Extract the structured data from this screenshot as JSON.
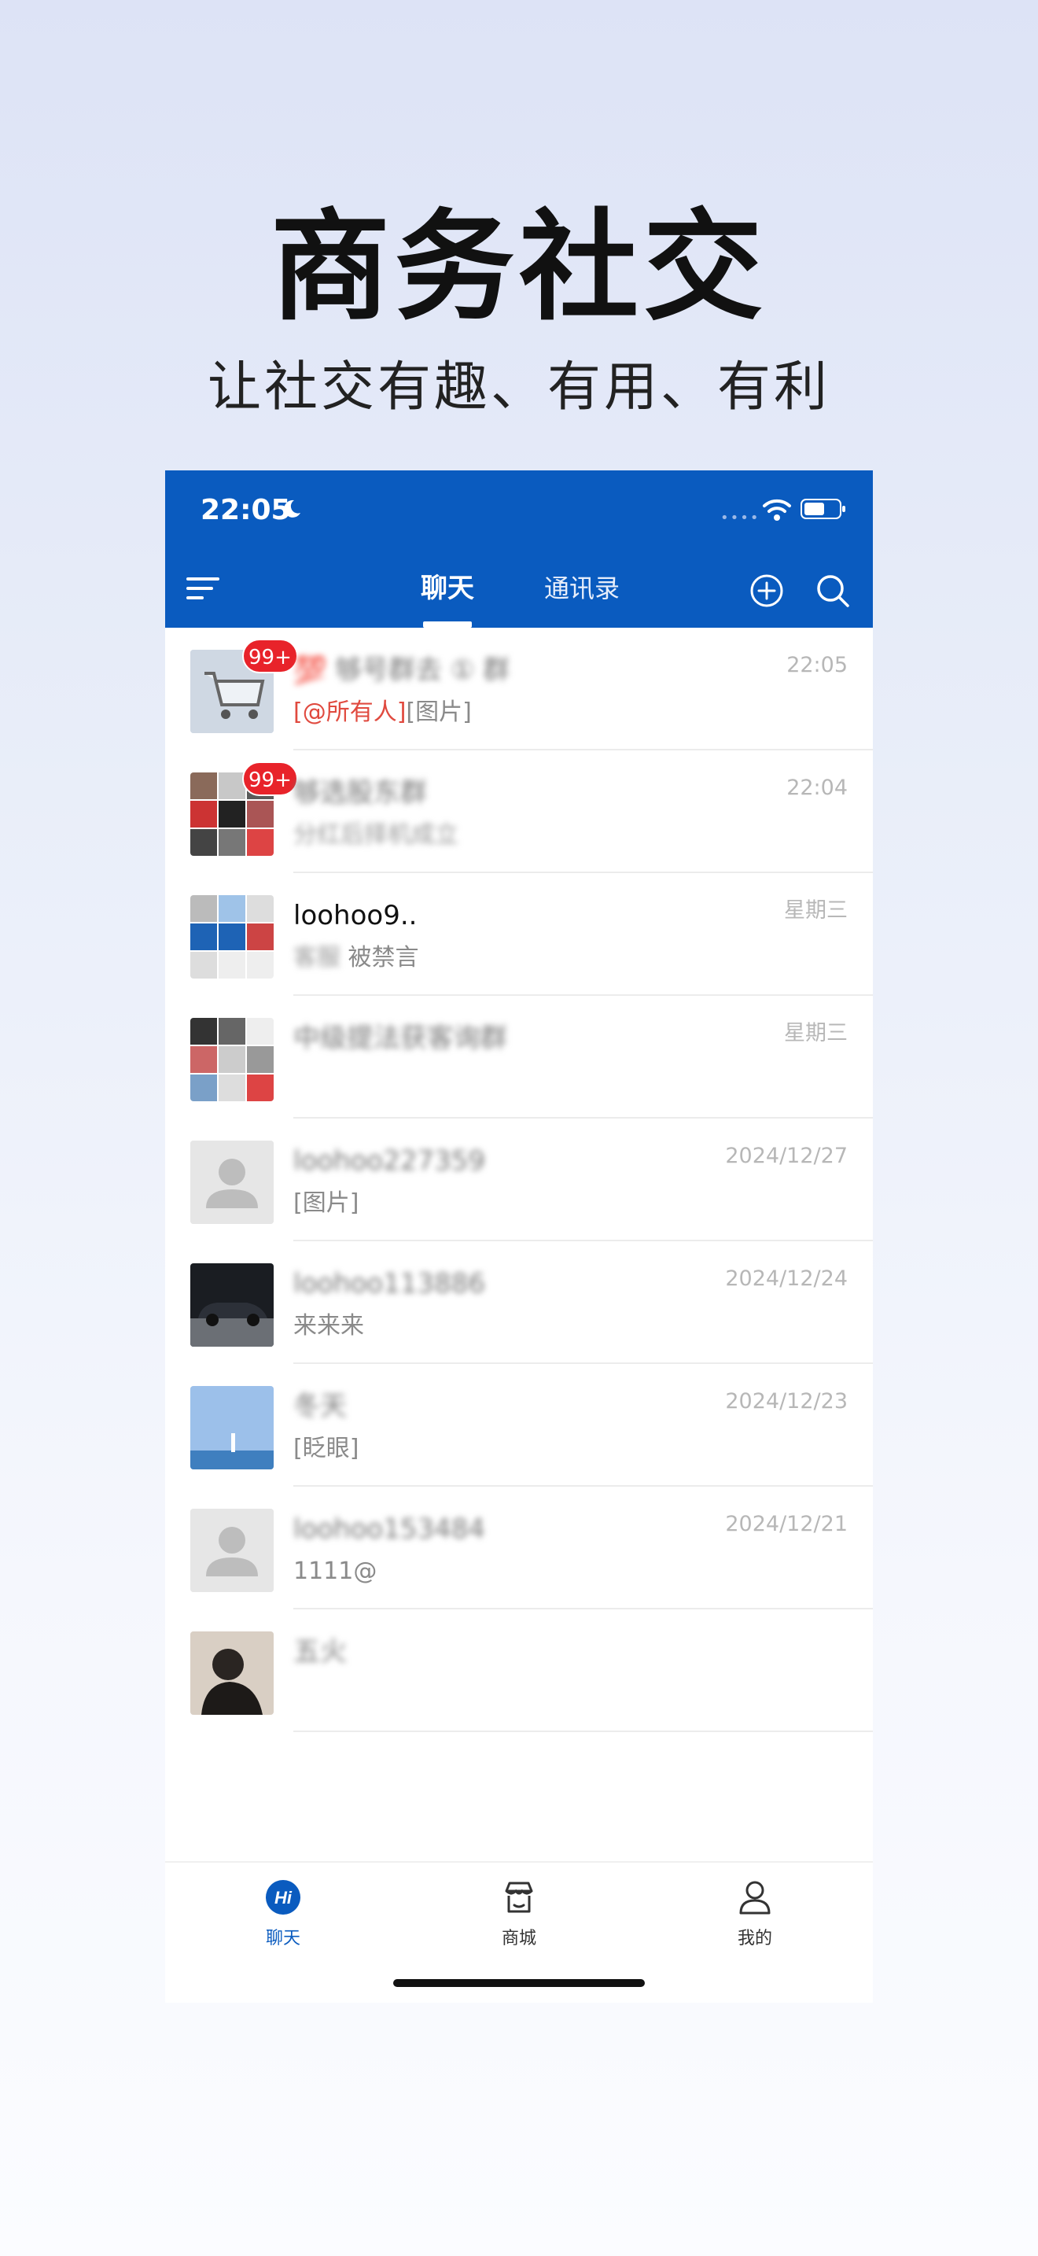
{
  "hero": {
    "title": "商务社交",
    "subtitle": "让社交有趣、有用、有利"
  },
  "status_bar": {
    "time": "22:05",
    "battery_level": 0.6
  },
  "header": {
    "tabs": [
      {
        "label": "聊天",
        "active": true
      },
      {
        "label": "通讯录",
        "active": false
      }
    ]
  },
  "chats": [
    {
      "name": "💯 够号群去 ① 群",
      "preview_mention": "[@所有人]",
      "preview": "[图片]",
      "time": "22:05",
      "badge": "99+",
      "avatar": "cart-photo"
    },
    {
      "name": "够选股东群",
      "preview": "分红后择机成立",
      "time": "22:04",
      "badge": "99+",
      "avatar": "group-grid"
    },
    {
      "name": "loohoo9..",
      "preview_prefix": "客服",
      "preview": "被禁言",
      "time": "星期三",
      "avatar": "group-grid-blue"
    },
    {
      "name": "中级提法获客询群",
      "preview": "",
      "time": "星期三",
      "avatar": "group-grid"
    },
    {
      "name": "loohoo227359",
      "preview": "[图片]",
      "time": "2024/12/27",
      "avatar": "default-person"
    },
    {
      "name": "loohoo113886",
      "preview": "来来来",
      "time": "2024/12/24",
      "avatar": "car-photo"
    },
    {
      "name": "冬天",
      "preview": "[眨眼]",
      "time": "2024/12/23",
      "avatar": "sea-photo"
    },
    {
      "name": "loohoo153484",
      "preview": "1111@",
      "time": "2024/12/21",
      "avatar": "default-person"
    },
    {
      "name": "五火",
      "preview": "",
      "time": "",
      "avatar": "portrait-photo"
    }
  ],
  "tabbar": {
    "items": [
      {
        "label": "聊天",
        "active": true
      },
      {
        "label": "商城",
        "active": false
      },
      {
        "label": "我的",
        "active": false
      }
    ]
  },
  "colors": {
    "brand_blue": "#0a5bbf",
    "badge_red": "#e8232a",
    "mention_red": "#e04a3f"
  }
}
